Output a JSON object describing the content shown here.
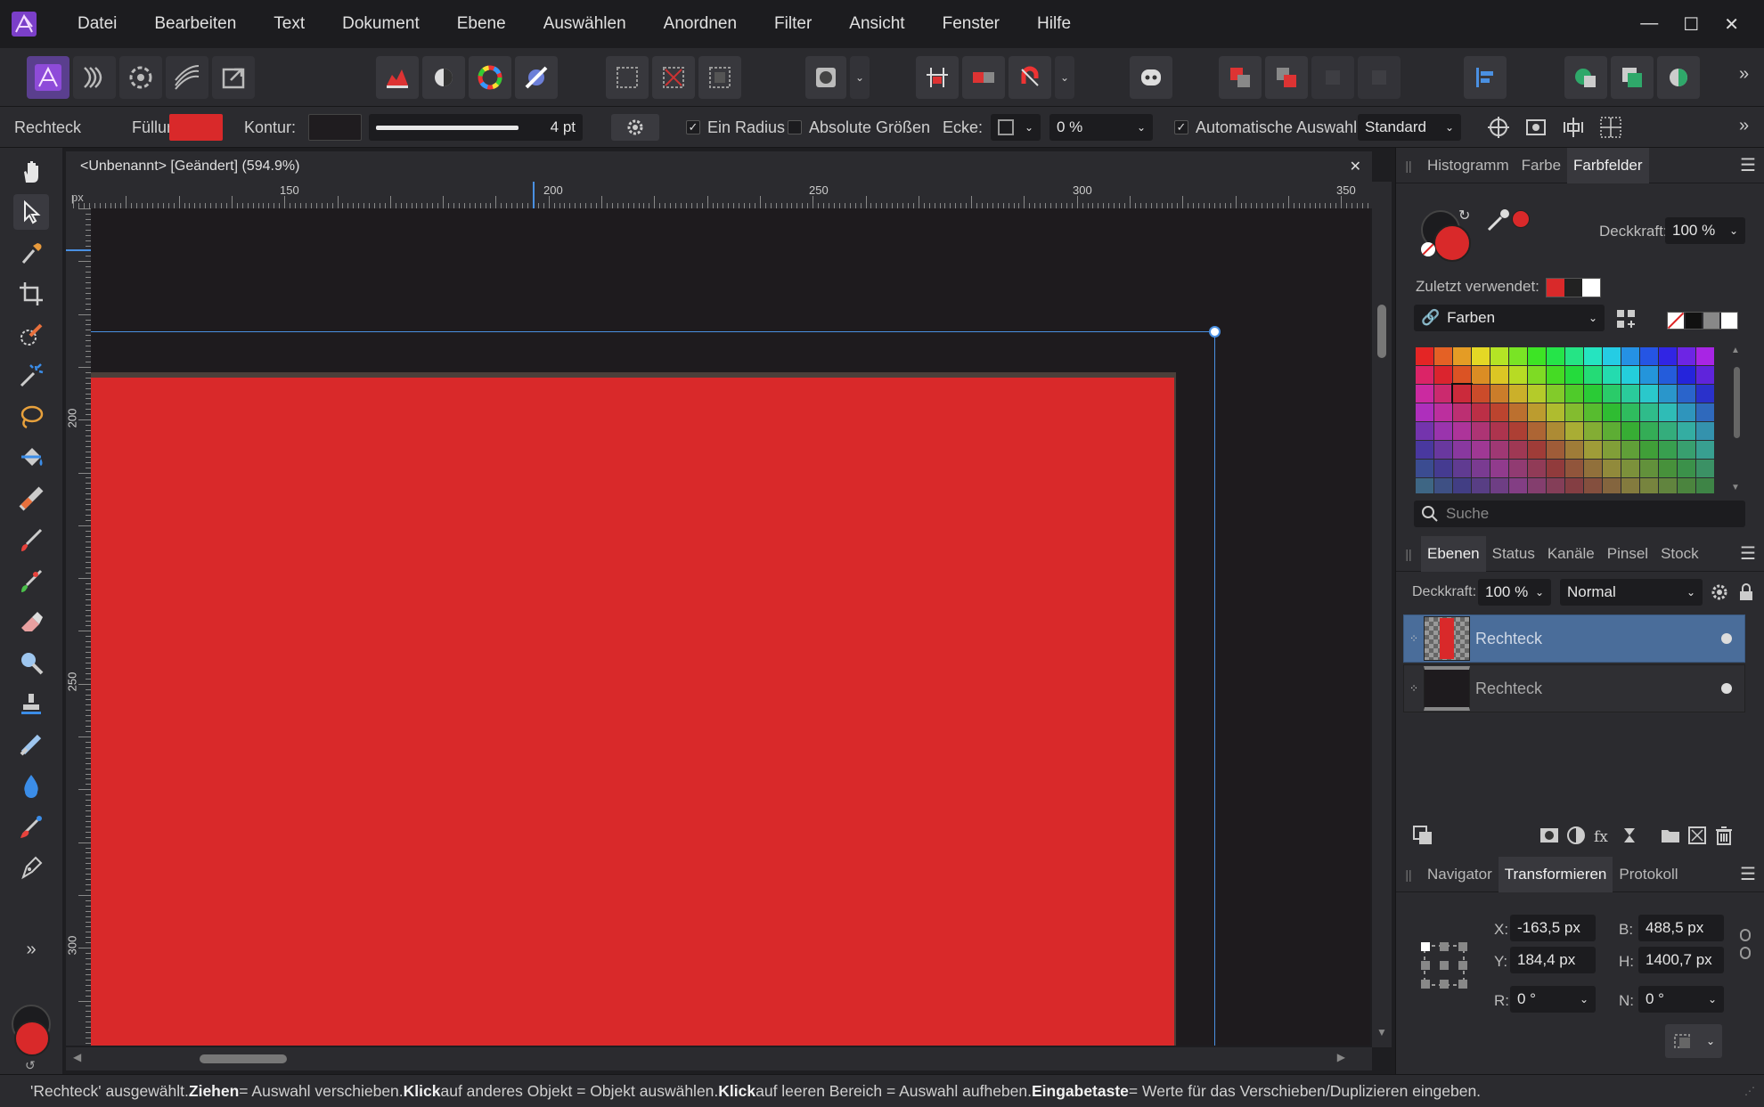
{
  "menubar": {
    "items": [
      "Datei",
      "Bearbeiten",
      "Text",
      "Dokument",
      "Ebene",
      "Auswählen",
      "Anordnen",
      "Filter",
      "Ansicht",
      "Fenster",
      "Hilfe"
    ],
    "minimize": "—",
    "maximize": "☐",
    "close": "✕"
  },
  "contextbar": {
    "tool_name": "Rechteck",
    "fill_label": "Füllung:",
    "fill_color": "#d9292a",
    "stroke_label": "Kontur:",
    "stroke_color": "#1f1c1f",
    "stroke_width": "4 pt",
    "single_radius_label": "Ein Radius",
    "absolute_sizes_label": "Absolute Größen",
    "corner_label": "Ecke:",
    "corner_value": "0 %",
    "auto_select_label": "Automatische Auswahl:",
    "auto_select_value": "Standard"
  },
  "document": {
    "tab_title": "<Unbenannt> [Geändert] (594.9%)",
    "close_icon": "✕",
    "ruler_unit": "px",
    "ruler_h_labels": [
      "150",
      "200",
      "250",
      "300",
      "350"
    ],
    "ruler_v_labels": [
      "200",
      "250",
      "300"
    ]
  },
  "colors": {
    "accent": "#4a90e2",
    "rect_red": "#d9292a",
    "canvas_dark": "#1e1b1e",
    "selected_layer": "#4a6d9a"
  },
  "swatches_panel": {
    "tabs": [
      "Histogramm",
      "Farbe",
      "Farbfelder"
    ],
    "active_tab": "Farbfelder",
    "opacity_label": "Deckkraft:",
    "opacity_value": "100 %",
    "recent_label": "Zuletzt verwendet:",
    "palette_name": "Farben",
    "search_placeholder": "Suche"
  },
  "layers_panel": {
    "tabs": [
      "Ebenen",
      "Status",
      "Kanäle",
      "Pinsel",
      "Stock"
    ],
    "active_tab": "Ebenen",
    "opacity_label": "Deckkraft:",
    "opacity_value": "100 %",
    "blend_mode": "Normal",
    "layers": [
      {
        "name": "Rechteck",
        "selected": true
      },
      {
        "name": "Rechteck",
        "selected": false
      }
    ]
  },
  "transform_panel": {
    "tabs": [
      "Navigator",
      "Transformieren",
      "Protokoll"
    ],
    "active_tab": "Transformieren",
    "x_label": "X:",
    "x_value": "-163,5 px",
    "y_label": "Y:",
    "y_value": "184,4 px",
    "w_label": "B:",
    "w_value": "488,5 px",
    "h_label": "H:",
    "h_value": "1400,7 px",
    "r_label": "R:",
    "r_value": "0 °",
    "s_label": "N:",
    "s_value": "0 °"
  },
  "statusbar": {
    "p1": "'Rechteck' ausgewählt. ",
    "b1": "Ziehen",
    "p2": " = Auswahl verschieben. ",
    "b2": "Klick",
    "p3": " auf anderes Objekt = Objekt auswählen. ",
    "b3": "Klick",
    "p4": " auf leeren Bereich = Auswahl aufheben. ",
    "b4": "Eingabetaste",
    "p5": " = Werte für das Verschieben/Duplizieren eingeben."
  }
}
